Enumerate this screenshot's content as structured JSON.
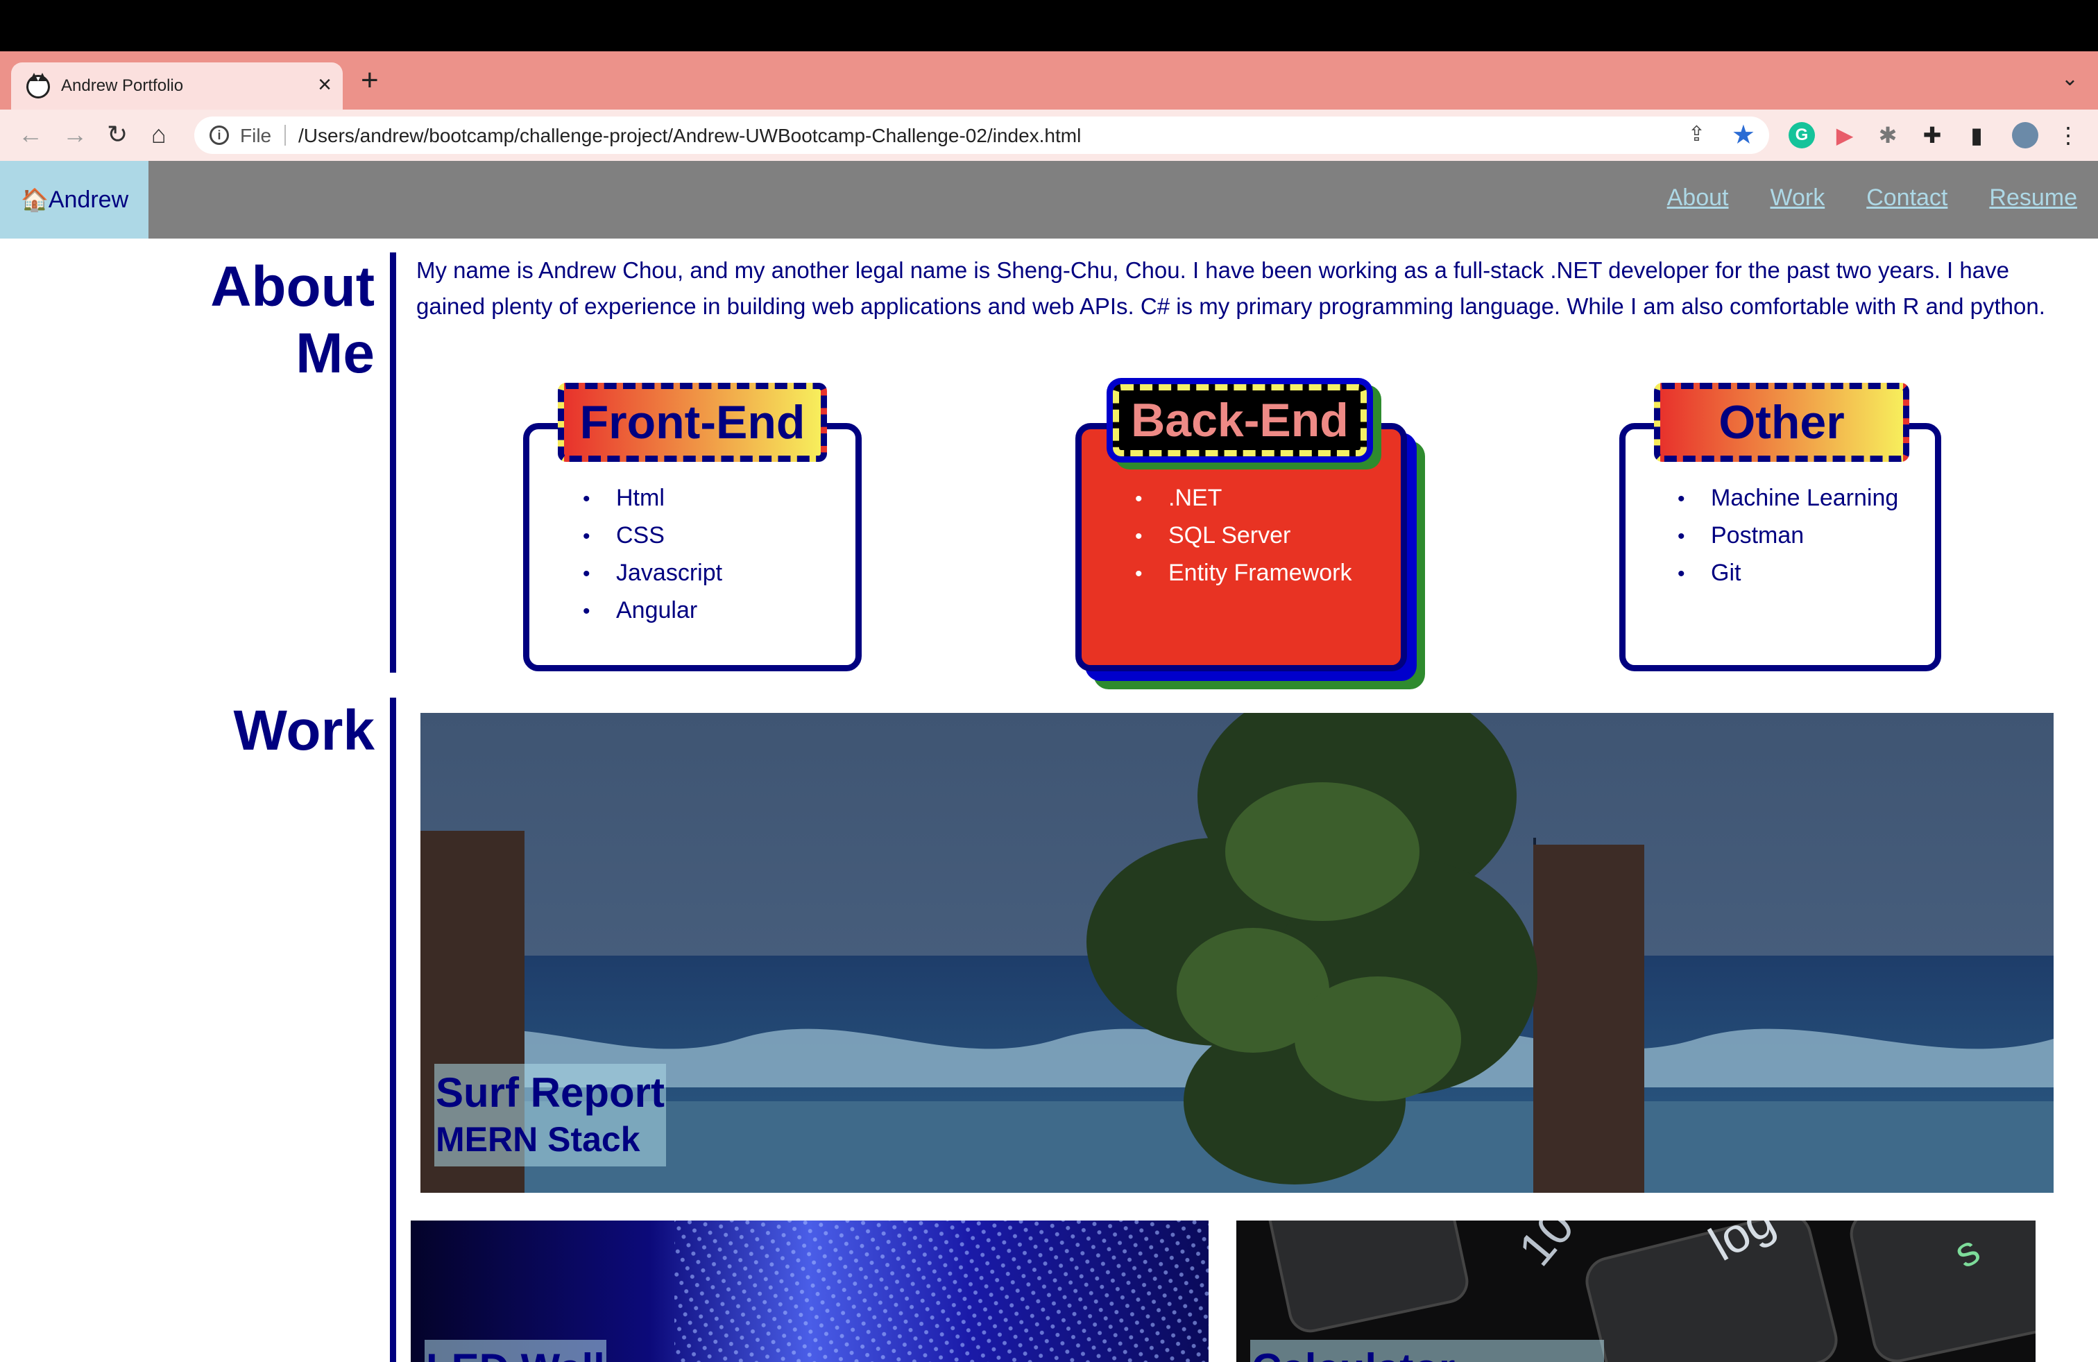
{
  "browser": {
    "tab_title": "Andrew Portfolio",
    "tab_close": "×",
    "new_tab": "+",
    "tab_list": "⌄",
    "back": "←",
    "forward": "→",
    "reload": "↻",
    "home": "⌂",
    "info_glyph": "i",
    "url_scheme_label": "File",
    "url": "/Users/andrew/bootcamp/challenge-project/Andrew-UWBootcamp-Challenge-02/index.html",
    "share_glyph": "⇪",
    "bookmark_glyph": "★",
    "extensions": [
      {
        "icon": "grammarly-icon",
        "glyph": "G"
      },
      {
        "icon": "screen-recorder-icon",
        "glyph": "▶"
      },
      {
        "icon": "bug-icon",
        "glyph": "✱"
      },
      {
        "icon": "puzzle-icon",
        "glyph": "✚"
      },
      {
        "icon": "sidepanel-icon",
        "glyph": "▮"
      }
    ],
    "menu_glyph": "⋮",
    "colors": {
      "tabstrip": "#ec928a",
      "active_tab": "#fbe0de",
      "bookmark_star": "#2b6cd4"
    }
  },
  "site": {
    "brand": {
      "icon_glyph": "🏠",
      "label": "Andrew"
    },
    "nav": [
      "About",
      "Work",
      "Contact",
      "Resume"
    ],
    "colors": {
      "header": "#808080",
      "brand_bg": "#add8e6",
      "primary": "#000080"
    }
  },
  "about": {
    "heading_line1": "About",
    "heading_line2": "Me",
    "paragraph": "My name is Andrew Chou, and my another legal name is Sheng-Chu, Chou. I have been working as a full-stack .NET developer for the past two years. I have gained plenty of experience in building web applications and web APIs. C# is my primary programming language. While I am also comfortable with R and python.",
    "skills": [
      {
        "title": "Front-End",
        "items": [
          "Html",
          "CSS",
          "Javascript",
          "Angular"
        ]
      },
      {
        "title": "Back-End",
        "items": [
          ".NET",
          "SQL Server",
          "Entity Framework"
        ]
      },
      {
        "title": "Other",
        "items": [
          "Machine Learning",
          "Postman",
          "Git"
        ]
      }
    ]
  },
  "work": {
    "heading": "Work",
    "projects": [
      {
        "name": "Surf Report",
        "tech": "MERN Stack"
      },
      {
        "name": "LED Wall",
        "tech": ""
      },
      {
        "name": "Calculator",
        "tech": ""
      }
    ]
  }
}
